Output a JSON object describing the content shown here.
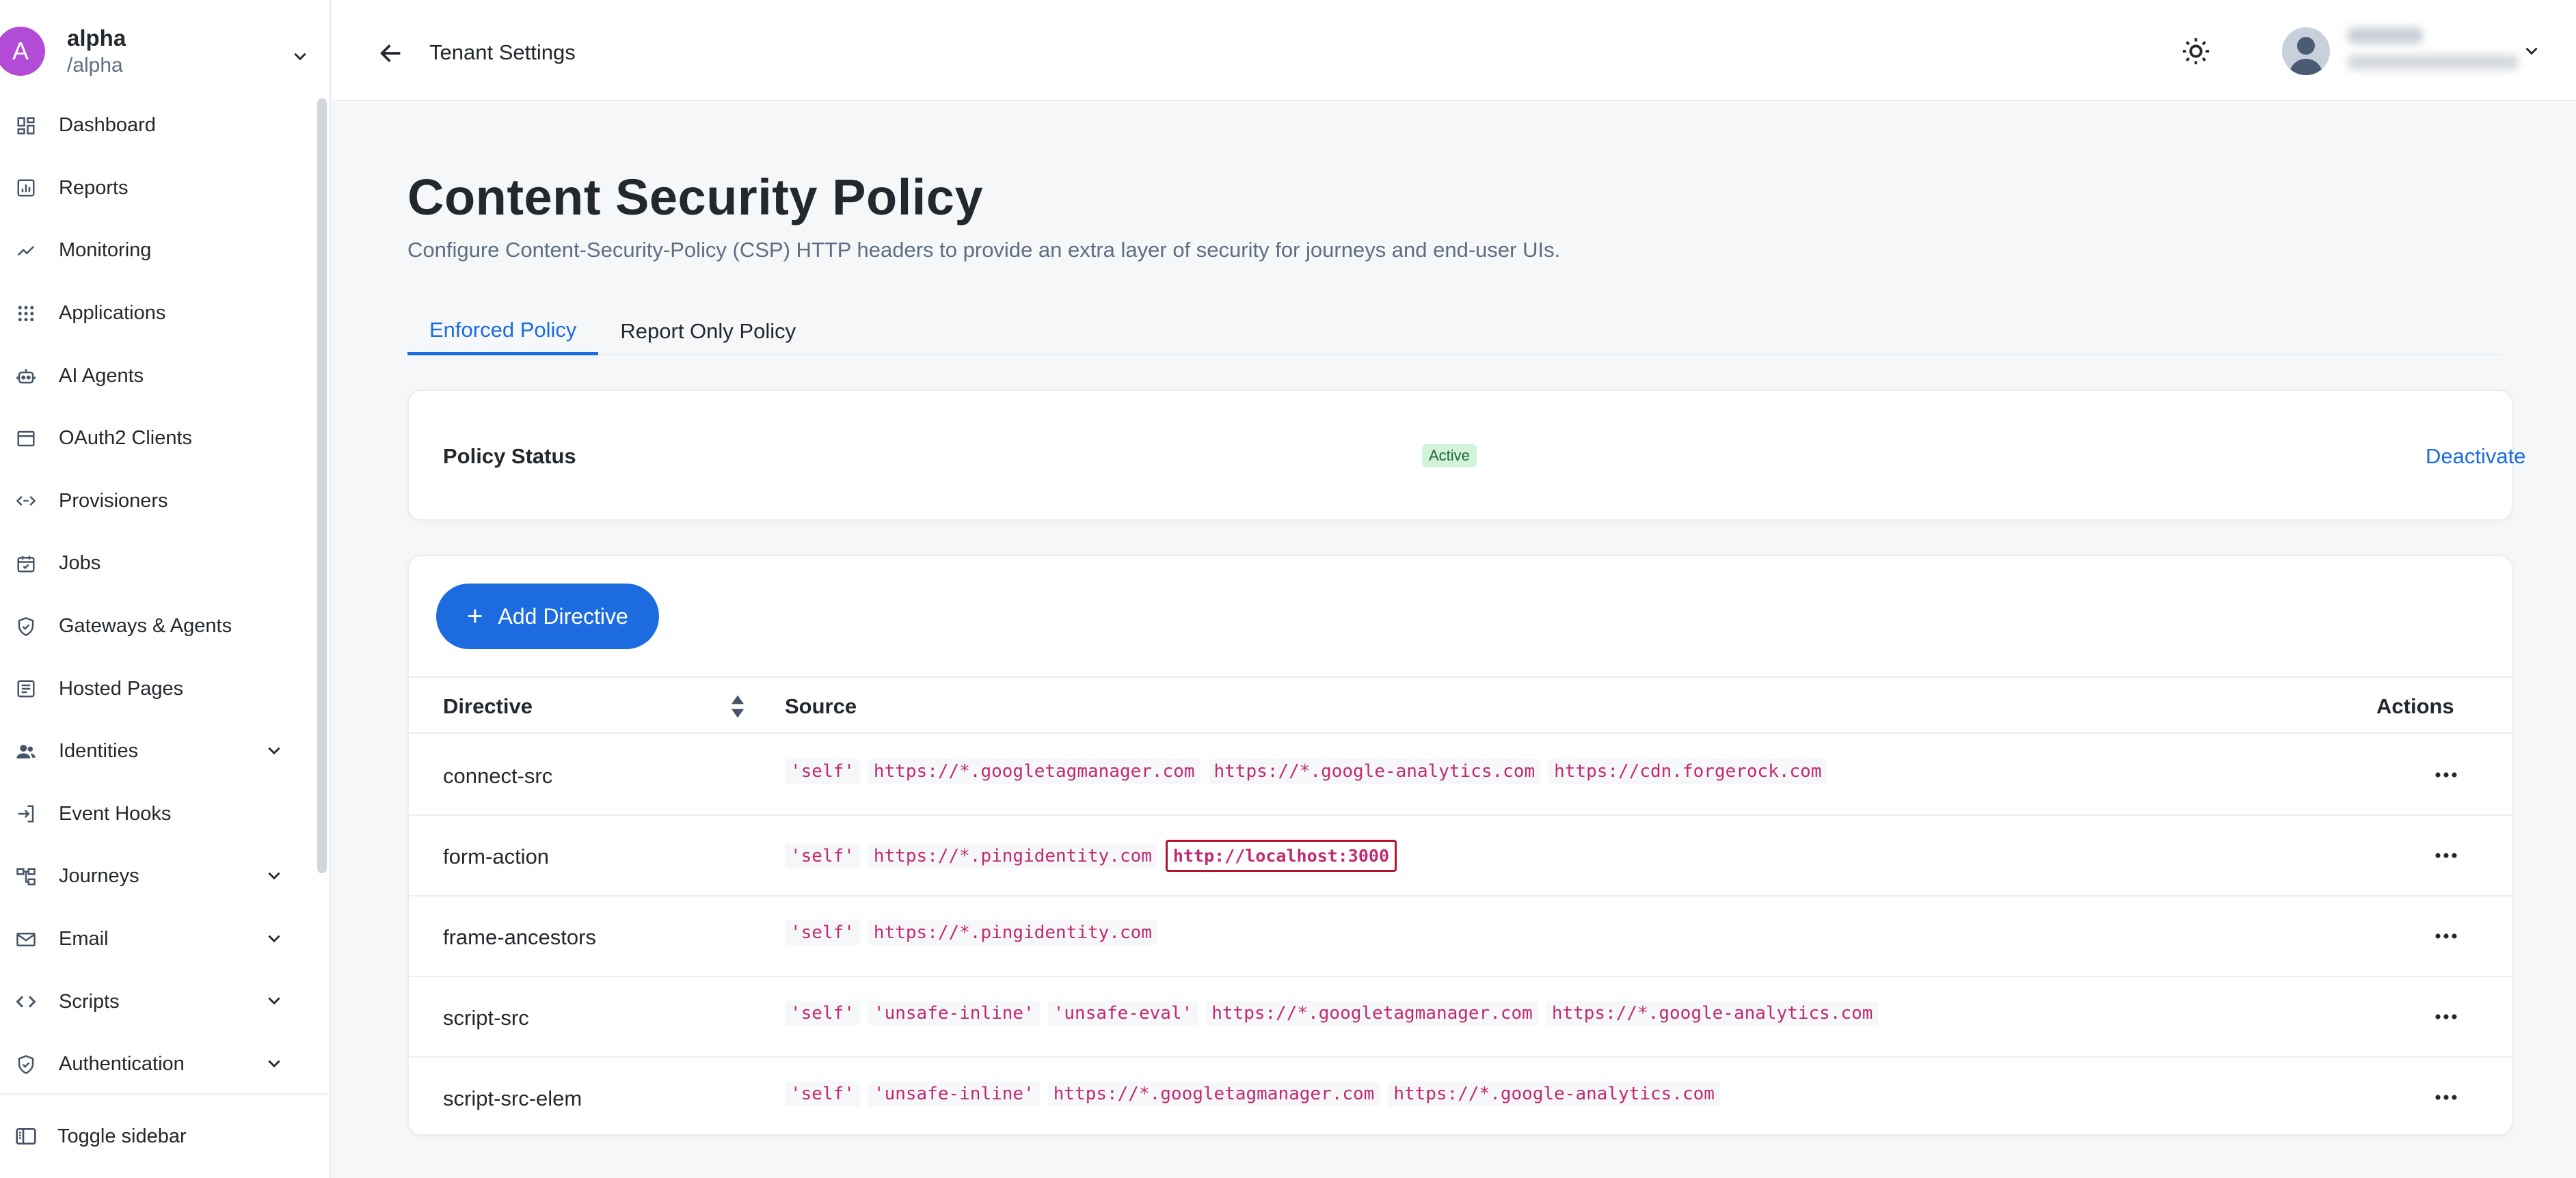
{
  "realm": {
    "initial": "A",
    "name": "alpha",
    "path": "/alpha"
  },
  "nav": {
    "items": [
      {
        "label": "Dashboard",
        "icon": "dashboard-icon"
      },
      {
        "label": "Reports",
        "icon": "reports-icon"
      },
      {
        "label": "Monitoring",
        "icon": "monitoring-icon"
      },
      {
        "label": "Applications",
        "icon": "applications-icon"
      },
      {
        "label": "AI Agents",
        "icon": "ai-agents-icon"
      },
      {
        "label": "OAuth2 Clients",
        "icon": "oauth2-clients-icon"
      },
      {
        "label": "Provisioners",
        "icon": "provisioners-icon"
      },
      {
        "label": "Jobs",
        "icon": "jobs-icon"
      },
      {
        "label": "Gateways & Agents",
        "icon": "gateways-icon"
      },
      {
        "label": "Hosted Pages",
        "icon": "hosted-pages-icon"
      },
      {
        "label": "Identities",
        "icon": "identities-icon"
      },
      {
        "label": "Event Hooks",
        "icon": "event-hooks-icon"
      },
      {
        "label": "Journeys",
        "icon": "journeys-icon"
      },
      {
        "label": "Email",
        "icon": "email-icon"
      },
      {
        "label": "Scripts",
        "icon": "scripts-icon"
      },
      {
        "label": "Authentication",
        "icon": "authentication-icon"
      }
    ],
    "toggle_label": "Toggle sidebar"
  },
  "header": {
    "title": "Tenant Settings"
  },
  "page": {
    "title": "Content Security Policy",
    "subtitle": "Configure Content-Security-Policy (CSP) HTTP headers to provide an extra layer of security for journeys and end-user UIs.",
    "tabs": [
      "Enforced Policy",
      "Report Only Policy"
    ]
  },
  "status": {
    "label": "Policy Status",
    "badge": "Active",
    "action": "Deactivate"
  },
  "table": {
    "add_button": "Add Directive",
    "add_icon": "+",
    "headers": {
      "directive": "Directive",
      "source": "Source",
      "actions": "Actions"
    },
    "rows": [
      {
        "directive": "connect-src",
        "sources": [
          "'self'",
          "https://*.googletagmanager.com",
          "https://*.google-analytics.com",
          "https://cdn.forgerock.com"
        ]
      },
      {
        "directive": "form-action",
        "sources": [
          "'self'",
          "https://*.pingidentity.com",
          "http://localhost:3000"
        ]
      },
      {
        "directive": "frame-ancestors",
        "sources": [
          "'self'",
          "https://*.pingidentity.com"
        ]
      },
      {
        "directive": "script-src",
        "sources": [
          "'self'",
          "'unsafe-inline'",
          "'unsafe-eval'",
          "https://*.googletagmanager.com",
          "https://*.google-analytics.com"
        ]
      },
      {
        "directive": "script-src-elem",
        "sources": [
          "'self'",
          "'unsafe-inline'",
          "https://*.googletagmanager.com",
          "https://*.google-analytics.com"
        ]
      }
    ]
  },
  "colors": {
    "accent": "#1c6ce0",
    "realm_avatar": "#b24cd6",
    "source_text": "#c12a72",
    "badge_bg": "#d3f2dc",
    "highlight_border": "#b5122e"
  }
}
